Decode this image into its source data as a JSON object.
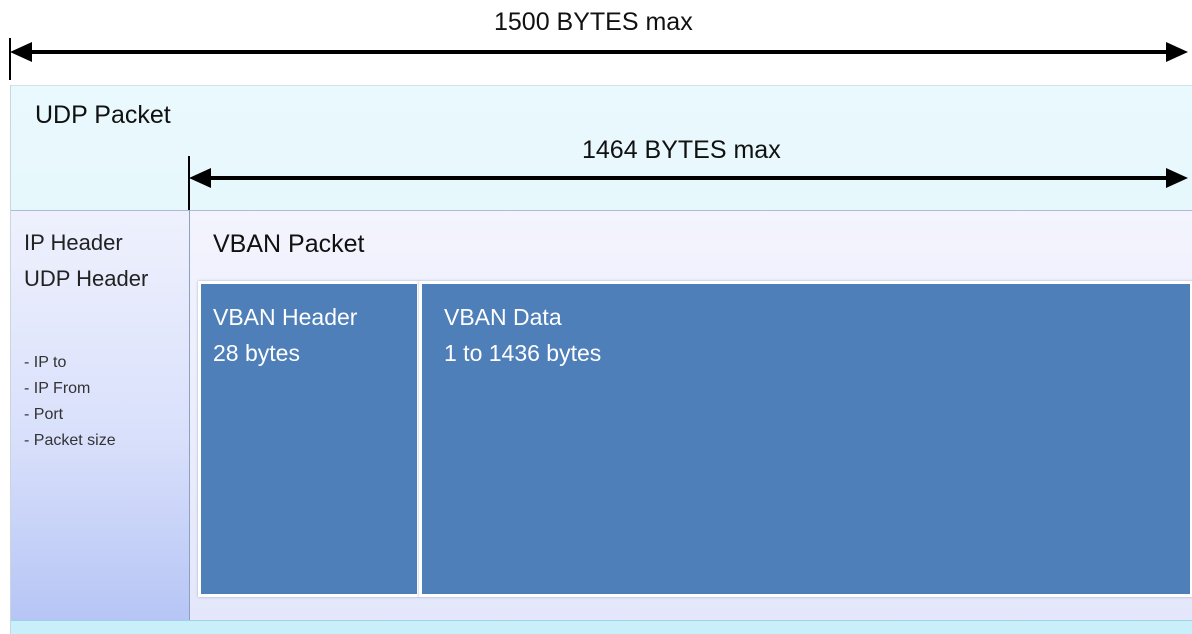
{
  "dimensions": {
    "total_max": "1500 BYTES max",
    "payload_max": "1464 BYTES max"
  },
  "udp_packet": {
    "title": "UDP Packet"
  },
  "header_column": {
    "lines": [
      "IP Header",
      "UDP Header"
    ],
    "bullets": [
      "- IP to",
      "- IP From",
      "- Port",
      "- Packet size"
    ]
  },
  "vban_packet": {
    "title": "VBAN Packet",
    "header_box": {
      "title": "VBAN Header",
      "size": "28 bytes"
    },
    "data_box": {
      "title": "VBAN Data",
      "size": "1 to 1436 bytes"
    }
  },
  "colors": {
    "vban_box_fill": "#4e7fb9",
    "udp_background": "#e0f5fb",
    "header_column_gradient_bottom": "#b6c5f5",
    "arrow_color": "#000000"
  }
}
